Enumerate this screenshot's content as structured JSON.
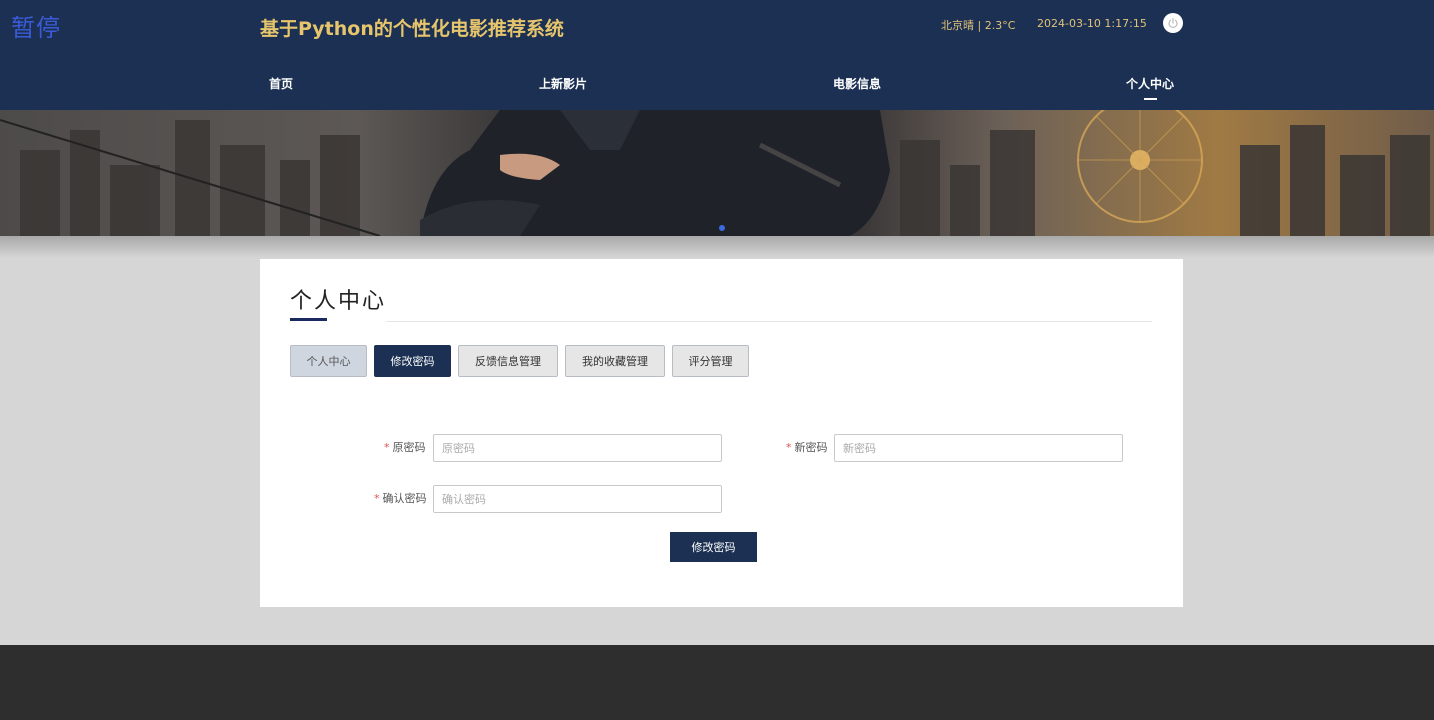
{
  "overlay": {
    "paused_label": "暂停"
  },
  "header": {
    "title": "基于Python的个性化电影推荐系统",
    "weather": "北京晴 | 2.3°C",
    "datetime": "2024-03-10   1:17:15",
    "power_icon": "power-icon"
  },
  "nav": {
    "items": [
      {
        "label": "首页"
      },
      {
        "label": "上新影片"
      },
      {
        "label": "电影信息"
      },
      {
        "label": "个人中心"
      }
    ],
    "active": "个人中心"
  },
  "card": {
    "title": "个人中心",
    "tabs": [
      {
        "label": "个人中心"
      },
      {
        "label": "修改密码"
      },
      {
        "label": "反馈信息管理"
      },
      {
        "label": "我的收藏管理"
      },
      {
        "label": "评分管理"
      }
    ],
    "active_tab": "修改密码"
  },
  "form": {
    "required_mark": "*",
    "old_password": {
      "label": "原密码",
      "placeholder": "原密码",
      "value": ""
    },
    "new_password": {
      "label": "新密码",
      "placeholder": "新密码",
      "value": ""
    },
    "confirm_password": {
      "label": "确认密码",
      "placeholder": "确认密码",
      "value": ""
    },
    "submit_label": "修改密码"
  },
  "colors": {
    "primary": "#1b3052",
    "title_gold": "#e7c56c",
    "required": "#e05050"
  }
}
